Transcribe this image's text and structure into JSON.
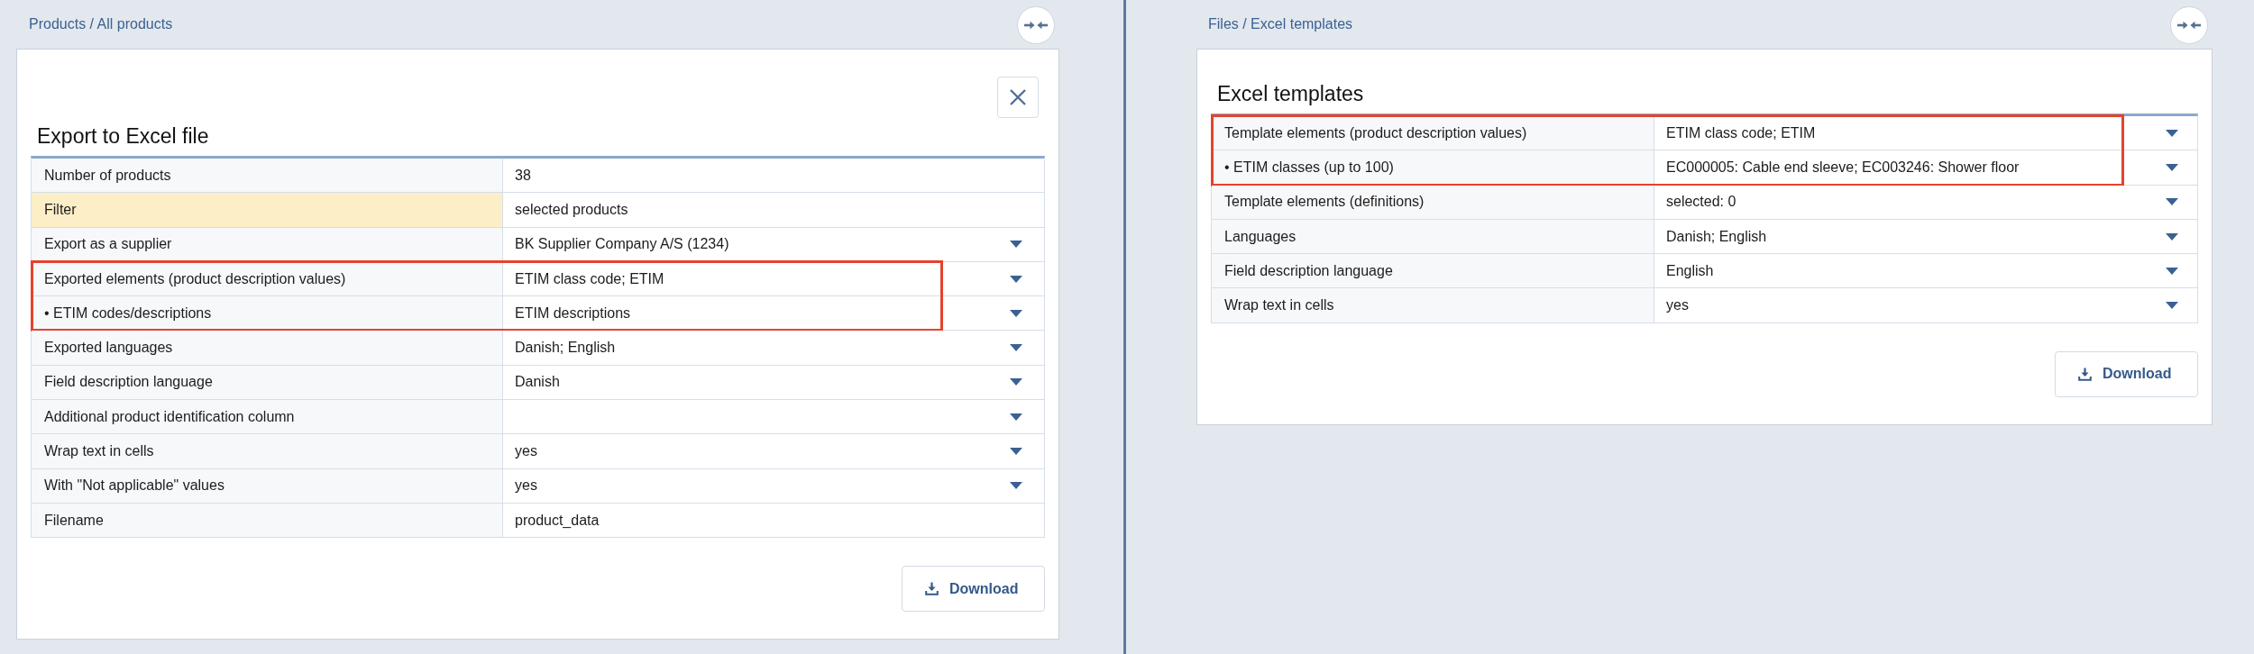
{
  "panels": [
    {
      "breadcrumb": "Products / All products",
      "closable": true,
      "title": "Export to Excel file",
      "rows": [
        {
          "label": "Number of products",
          "value": "38",
          "kind": "text",
          "flagged": false,
          "highlighted": false
        },
        {
          "label": "Filter",
          "value": "selected products",
          "kind": "text",
          "flagged": true,
          "highlighted": false
        },
        {
          "label": "Export as a supplier",
          "value": "BK Supplier Company A/S (1234)",
          "kind": "select",
          "flagged": false,
          "highlighted": false
        },
        {
          "label": "Exported elements (product description values)",
          "value": "ETIM class code; ETIM",
          "kind": "select",
          "flagged": false,
          "highlighted": true
        },
        {
          "label": "• ETIM codes/descriptions",
          "value": "ETIM descriptions",
          "kind": "select",
          "flagged": false,
          "highlighted": true
        },
        {
          "label": "Exported languages",
          "value": "Danish; English",
          "kind": "select",
          "flagged": false,
          "highlighted": false
        },
        {
          "label": "Field description language",
          "value": "Danish",
          "kind": "select",
          "flagged": false,
          "highlighted": false
        },
        {
          "label": "Additional product identification column",
          "kind": "select",
          "flagged": false,
          "highlighted": false
        },
        {
          "label": "Wrap text in cells",
          "value": "yes",
          "kind": "select",
          "flagged": false,
          "highlighted": false
        },
        {
          "label": "With \"Not applicable\" values",
          "value": "yes",
          "kind": "select",
          "flagged": false,
          "highlighted": false
        },
        {
          "label": "Filename",
          "value": "product_data",
          "kind": "text",
          "flagged": false,
          "highlighted": false
        }
      ],
      "download_button": "Download"
    },
    {
      "breadcrumb": "Files / Excel templates",
      "closable": false,
      "title": "Excel templates",
      "rows": [
        {
          "label": "Template elements (product description values)",
          "value": "ETIM class code; ETIM",
          "kind": "select",
          "flagged": false,
          "highlighted": true
        },
        {
          "label": "• ETIM classes (up to 100)",
          "value": "EC000005: Cable end sleeve; EC003246: Shower floor",
          "kind": "select",
          "flagged": false,
          "highlighted": true
        },
        {
          "label": "Template elements (definitions)",
          "value": "selected: 0",
          "kind": "select",
          "flagged": false,
          "highlighted": false
        },
        {
          "label": "Languages",
          "value": "Danish; English",
          "kind": "select",
          "flagged": false,
          "highlighted": false
        },
        {
          "label": "Field description language",
          "value": "English",
          "kind": "select",
          "flagged": false,
          "highlighted": false
        },
        {
          "label": "Wrap text in cells",
          "value": "yes",
          "kind": "select",
          "flagged": false,
          "highlighted": false
        }
      ],
      "download_button": "Download"
    }
  ]
}
